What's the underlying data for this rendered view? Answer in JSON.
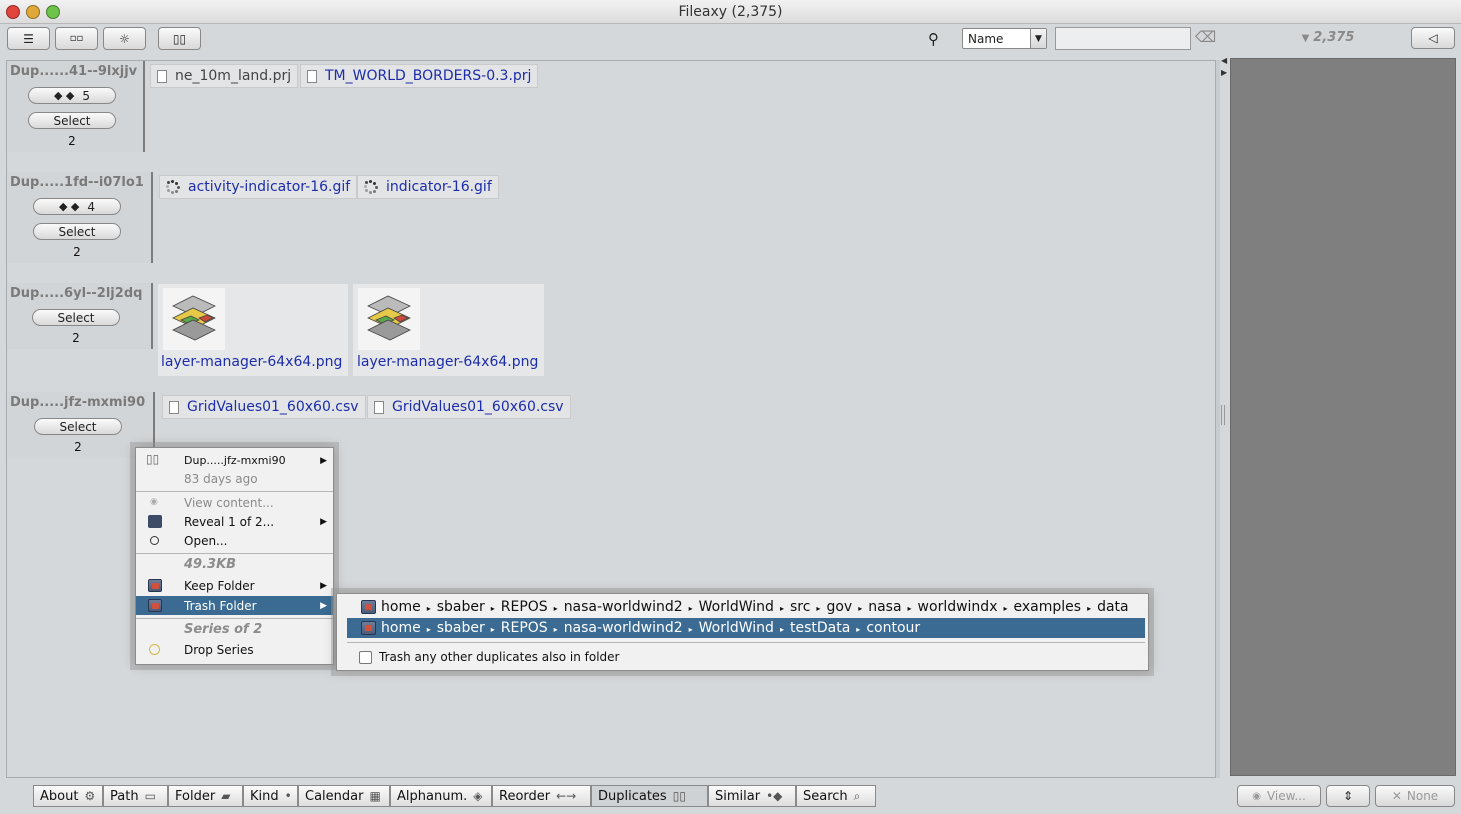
{
  "window": {
    "title": "Fileaxy  (2,375)"
  },
  "toolbar": {
    "menu_icon": "hamburger-icon",
    "layout_icon": "dual-pane-icon",
    "gear_icon": "gear-icon",
    "dup_icon": "duplicate-docs-icon",
    "sort_value": "Name",
    "search_placeholder": ""
  },
  "right_panel": {
    "count": "2,375",
    "view_label": "View...",
    "none_label": "None"
  },
  "groups": [
    {
      "header": "Dup......41--9lxjjv",
      "count_btn": "5",
      "select_label": "Select",
      "count": "2",
      "files": [
        "ne_10m_land.prj",
        "TM_WORLD_BORDERS-0.3.prj"
      ]
    },
    {
      "header": "Dup.....1fd--i07lo1",
      "count_btn": "4",
      "select_label": "Select",
      "count": "2",
      "files": [
        "activity-indicator-16.gif",
        "indicator-16.gif"
      ]
    },
    {
      "header": "Dup.....6yl--2lj2dq",
      "select_label": "Select",
      "count": "2",
      "files": [
        "layer-manager-64x64.png",
        "layer-manager-64x64.png"
      ]
    },
    {
      "header": "Dup.....jfz-mxmi90",
      "select_label": "Select",
      "count": "2",
      "files": [
        "GridValues01_60x60.csv",
        "GridValues01_60x60.csv"
      ]
    }
  ],
  "context_menu": {
    "title": "Dup.....jfz-mxmi90",
    "subtitle": "83 days ago",
    "view_content": "View content...",
    "reveal": "Reveal 1 of 2...",
    "open": "Open...",
    "size": "49.3KB",
    "keep_folder": "Keep Folder",
    "trash_folder": "Trash Folder",
    "series_header": "Series of 2",
    "drop_series": "Drop Series"
  },
  "submenu": {
    "path1": [
      "home",
      "sbaber",
      "REPOS",
      "nasa-worldwind2",
      "WorldWind",
      "src",
      "gov",
      "nasa",
      "worldwindx",
      "examples",
      "data"
    ],
    "path2": [
      "home",
      "sbaber",
      "REPOS",
      "nasa-worldwind2",
      "WorldWind",
      "testData",
      "contour"
    ],
    "checkbox_label": "Trash any other duplicates also in folder",
    "checkbox_checked": false
  },
  "tabs": [
    {
      "label": "About",
      "icon": "⚙"
    },
    {
      "label": "Path",
      "icon": "▭"
    },
    {
      "label": "Folder",
      "icon": "▰"
    },
    {
      "label": "Kind",
      "icon": "•"
    },
    {
      "label": "Calendar",
      "icon": "▦"
    },
    {
      "label": "Alphanum.",
      "icon": "◈"
    },
    {
      "label": "Reorder",
      "icon": "←→"
    },
    {
      "label": "Duplicates",
      "icon": "▯▯"
    },
    {
      "label": "Similar",
      "icon": "•◆"
    },
    {
      "label": "Search",
      "icon": "⌕"
    }
  ],
  "colors": {
    "selection": "#3b6b92",
    "link": "#1d2dab",
    "panel": "#7f7f7f"
  }
}
